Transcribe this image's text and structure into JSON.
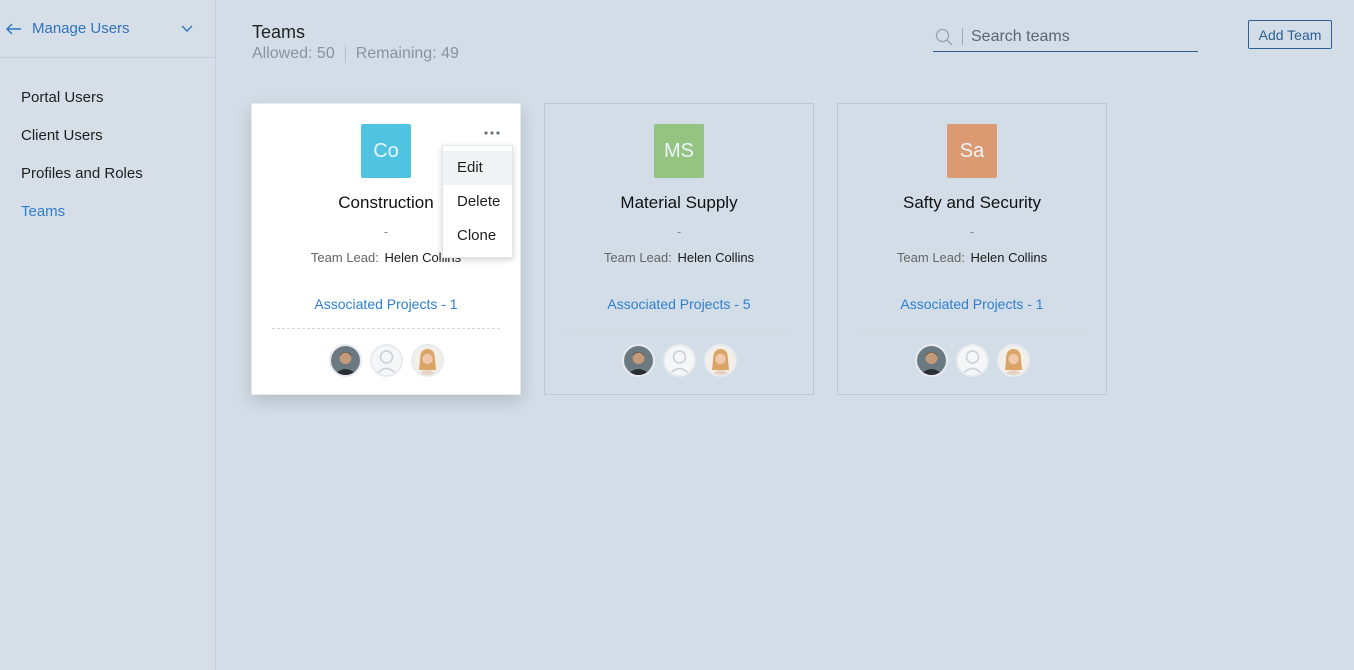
{
  "sidebar": {
    "title": "Manage Users",
    "items": [
      {
        "label": "Portal Users"
      },
      {
        "label": "Client Users"
      },
      {
        "label": "Profiles and Roles"
      },
      {
        "label": "Teams"
      }
    ]
  },
  "header": {
    "title": "Teams",
    "allowed": "Allowed: 50",
    "remaining": "Remaining: 49"
  },
  "search": {
    "placeholder": "Search teams"
  },
  "toolbar": {
    "add_label": "Add Team"
  },
  "teams": [
    {
      "initials": "Co",
      "name": "Construction",
      "dash": "-",
      "lead_label": "Team Lead:",
      "lead": "Helen Collins",
      "projects": "Associated Projects - 1",
      "color": "#4fc3df"
    },
    {
      "initials": "MS",
      "name": "Material Supply",
      "dash": "-",
      "lead_label": "Team Lead:",
      "lead": "Helen Collins",
      "projects": "Associated Projects - 5",
      "color": "#94c382"
    },
    {
      "initials": "Sa",
      "name": "Safty and Security",
      "dash": "-",
      "lead_label": "Team Lead:",
      "lead": "Helen Collins",
      "projects": "Associated Projects - 1",
      "color": "#dc9a72"
    }
  ],
  "menu": {
    "items": [
      "Edit",
      "Delete",
      "Clone"
    ]
  },
  "colors": {
    "accent": "#2f7fcf",
    "border_dark": "#2d5f93"
  }
}
